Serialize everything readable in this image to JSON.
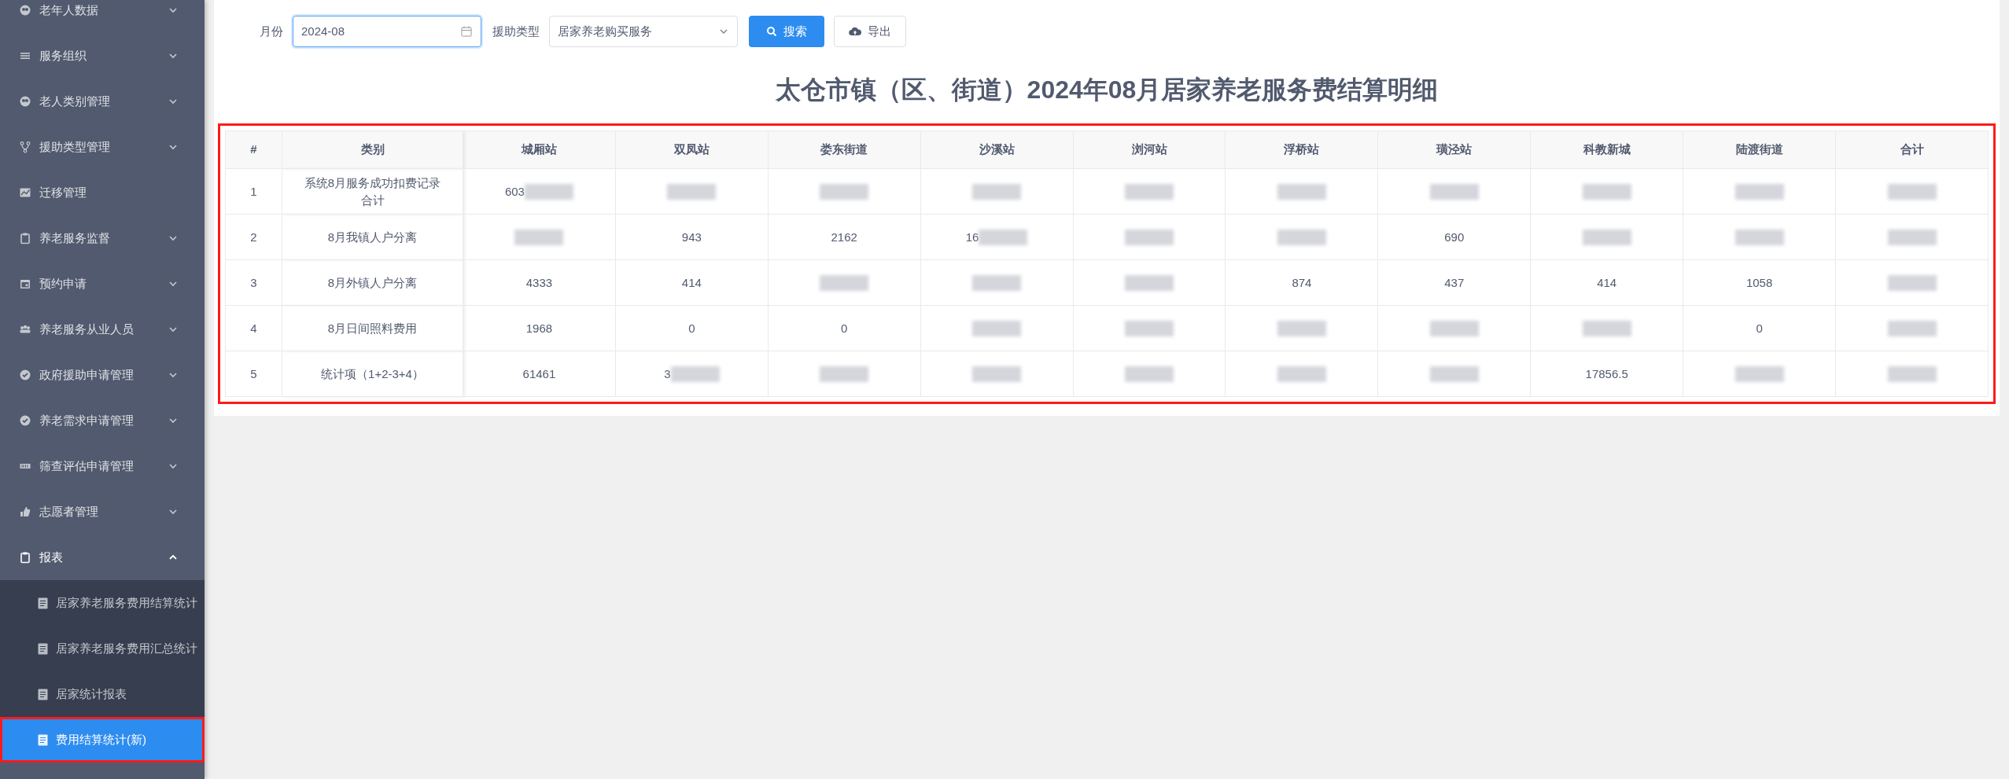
{
  "sidebar": {
    "items": [
      {
        "label": "老年人数据",
        "kind": "group",
        "expanded": false
      },
      {
        "label": "服务组织",
        "kind": "group",
        "expanded": false
      },
      {
        "label": "老人类别管理",
        "kind": "group",
        "expanded": false
      },
      {
        "label": "援助类型管理",
        "kind": "group",
        "expanded": false
      },
      {
        "label": "迁移管理",
        "kind": "link",
        "expanded": false
      },
      {
        "label": "养老服务监督",
        "kind": "group",
        "expanded": false
      },
      {
        "label": "预约申请",
        "kind": "group",
        "expanded": false
      },
      {
        "label": "养老服务从业人员",
        "kind": "group",
        "expanded": false
      },
      {
        "label": "政府援助申请管理",
        "kind": "group",
        "expanded": false
      },
      {
        "label": "养老需求申请管理",
        "kind": "group",
        "expanded": false
      },
      {
        "label": "筛查评估申请管理",
        "kind": "group",
        "expanded": false
      },
      {
        "label": "志愿者管理",
        "kind": "group",
        "expanded": false
      },
      {
        "label": "报表",
        "kind": "group",
        "expanded": true,
        "children": [
          {
            "label": "居家养老服务费用结算统计",
            "selected": false,
            "highlighted": false
          },
          {
            "label": "居家养老服务费用汇总统计",
            "selected": false,
            "highlighted": false
          },
          {
            "label": "居家统计报表",
            "selected": false,
            "highlighted": false
          },
          {
            "label": "费用结算统计(新)",
            "selected": true,
            "highlighted": true
          }
        ]
      }
    ]
  },
  "filters": {
    "month": {
      "label": "月份",
      "value": "2024-08"
    },
    "aid_type": {
      "label": "援助类型",
      "value": "居家养老购买服务"
    },
    "search_button": "搜索",
    "export_button": "导出"
  },
  "report": {
    "title": "太仓市镇（区、街道）2024年08月居家养老服务费结算明细",
    "highlighted": true,
    "columns": [
      "#",
      "类别",
      "城厢站",
      "双凤站",
      "娄东街道",
      "沙溪站",
      "浏河站",
      "浮桥站",
      "璜泾站",
      "科教新城",
      "陆渡街道",
      "合计"
    ],
    "rows": [
      {
        "cells": [
          {
            "text": "1",
            "redacted": false
          },
          {
            "text": "系统8月服务成功扣费记录合计",
            "redacted": false
          },
          {
            "text": "603",
            "redacted": true
          },
          {
            "redacted": true
          },
          {
            "redacted": true
          },
          {
            "redacted": true
          },
          {
            "redacted": true
          },
          {
            "redacted": true
          },
          {
            "redacted": true
          },
          {
            "redacted": true
          },
          {
            "redacted": true
          },
          {
            "redacted": true
          }
        ]
      },
      {
        "cells": [
          {
            "text": "2",
            "redacted": false
          },
          {
            "text": "8月我镇人户分离",
            "redacted": false
          },
          {
            "redacted": true
          },
          {
            "text": "943",
            "redacted": false
          },
          {
            "text": "2162",
            "redacted": false
          },
          {
            "text": "16",
            "redacted": true
          },
          {
            "redacted": true
          },
          {
            "redacted": true
          },
          {
            "text": "690",
            "redacted": false
          },
          {
            "redacted": true
          },
          {
            "redacted": true
          },
          {
            "redacted": true
          }
        ]
      },
      {
        "cells": [
          {
            "text": "3",
            "redacted": false
          },
          {
            "text": "8月外镇人户分离",
            "redacted": false
          },
          {
            "text": "4333",
            "redacted": false
          },
          {
            "text": "414",
            "redacted": false
          },
          {
            "redacted": true
          },
          {
            "redacted": true
          },
          {
            "redacted": true
          },
          {
            "text": "874",
            "redacted": false
          },
          {
            "text": "437",
            "redacted": false
          },
          {
            "text": "414",
            "redacted": false
          },
          {
            "text": "1058",
            "redacted": false
          },
          {
            "redacted": true
          }
        ]
      },
      {
        "cells": [
          {
            "text": "4",
            "redacted": false
          },
          {
            "text": "8月日间照料费用",
            "redacted": false
          },
          {
            "text": "1968",
            "redacted": false
          },
          {
            "text": "0",
            "redacted": false
          },
          {
            "text": "0",
            "redacted": false
          },
          {
            "redacted": true
          },
          {
            "redacted": true
          },
          {
            "redacted": true
          },
          {
            "redacted": true
          },
          {
            "redacted": true
          },
          {
            "text": "0",
            "redacted": false
          },
          {
            "redacted": true
          }
        ]
      },
      {
        "cells": [
          {
            "text": "5",
            "redacted": false
          },
          {
            "text": "统计项（1+2-3+4）",
            "redacted": false
          },
          {
            "text": "61461",
            "redacted": false
          },
          {
            "text": "3",
            "redacted": true
          },
          {
            "redacted": true
          },
          {
            "redacted": true
          },
          {
            "redacted": true
          },
          {
            "redacted": true
          },
          {
            "redacted": true
          },
          {
            "text": "17856.5",
            "redacted": false
          },
          {
            "redacted": true
          },
          {
            "redacted": true
          }
        ]
      }
    ]
  }
}
